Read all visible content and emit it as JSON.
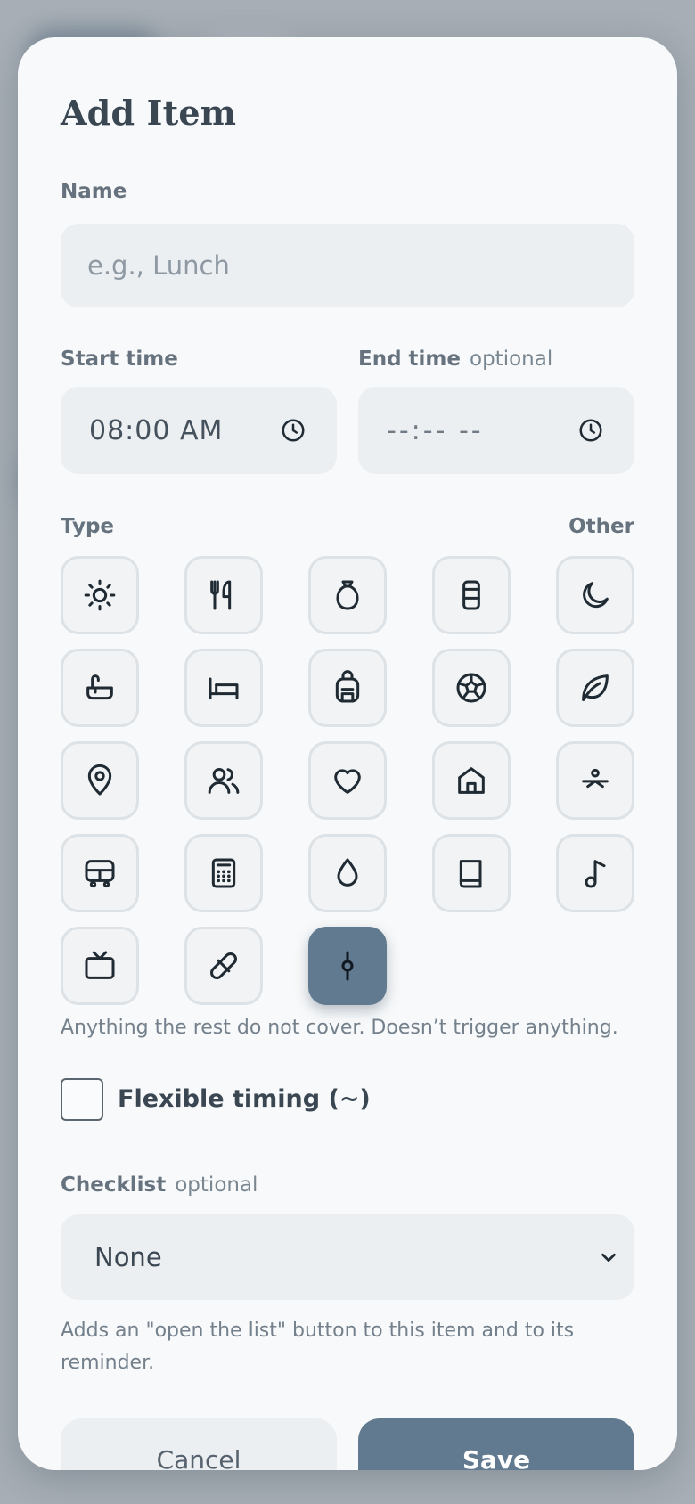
{
  "dialog": {
    "title": "Add Item",
    "name_label": "Name",
    "name_placeholder": "e.g., Lunch",
    "name_value": "",
    "start_label": "Start time",
    "start_value": "08:00 AM",
    "end_label": "End time",
    "end_optional": "optional",
    "end_value": "--:-- --",
    "type_label": "Type",
    "type_selected_name": "Other",
    "types": [
      {
        "name": "sun-icon"
      },
      {
        "name": "utensils-icon"
      },
      {
        "name": "sack-icon"
      },
      {
        "name": "cup-icon"
      },
      {
        "name": "moon-icon"
      },
      {
        "name": "bath-icon"
      },
      {
        "name": "bed-icon"
      },
      {
        "name": "backpack-icon"
      },
      {
        "name": "soccer-ball-icon"
      },
      {
        "name": "leaf-icon"
      },
      {
        "name": "map-pin-icon"
      },
      {
        "name": "users-icon"
      },
      {
        "name": "heart-icon"
      },
      {
        "name": "home-icon"
      },
      {
        "name": "swimmer-icon"
      },
      {
        "name": "bus-icon"
      },
      {
        "name": "calculator-icon"
      },
      {
        "name": "droplet-icon"
      },
      {
        "name": "book-icon"
      },
      {
        "name": "music-note-icon"
      },
      {
        "name": "tv-icon"
      },
      {
        "name": "pill-icon"
      },
      {
        "name": "commit-icon",
        "selected": true
      }
    ],
    "type_hint": "Anything the rest do not cover. Doesn’t trigger anything.",
    "flexible_label": "Flexible timing (~)",
    "flexible_checked": false,
    "checklist_label": "Checklist",
    "checklist_optional": "optional",
    "checklist_value": "None",
    "checklist_hint": "Adds an \"open the list\" button to this item and to its reminder.",
    "cancel_label": "Cancel",
    "save_label": "Save"
  },
  "colors": {
    "accent": "#627a8f",
    "field_bg": "#eceff2",
    "backdrop": "#a7aeb5"
  }
}
